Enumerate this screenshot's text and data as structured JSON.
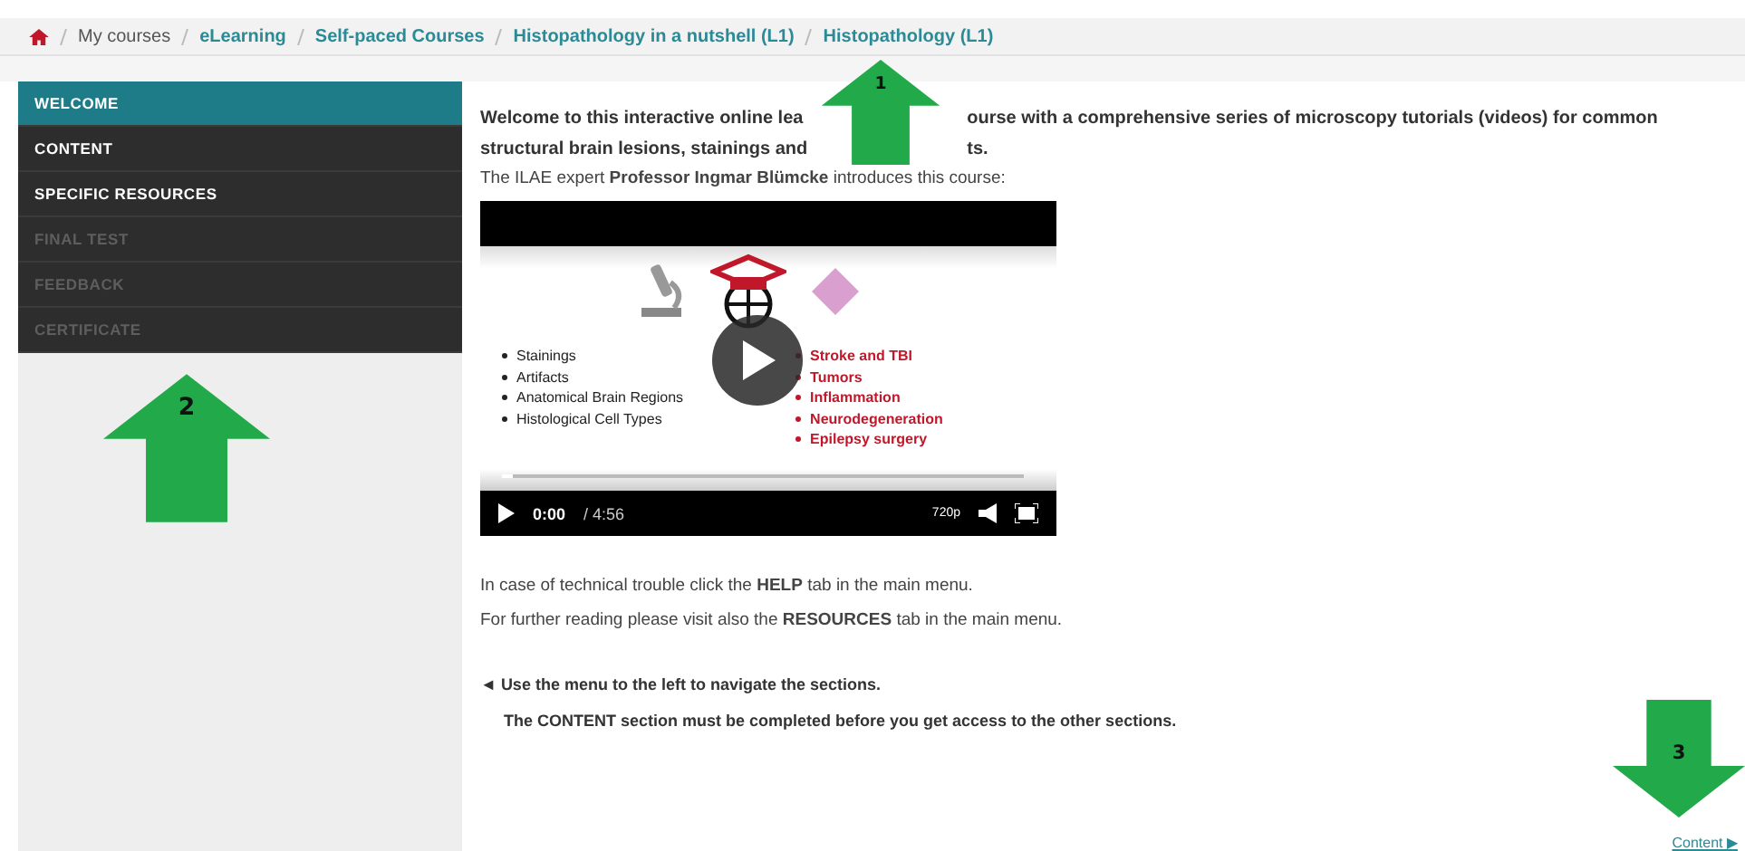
{
  "breadcrumb": [
    {
      "label": "My courses",
      "link": false
    },
    {
      "label": "eLearning",
      "link": true
    },
    {
      "label": "Self-paced Courses",
      "link": true
    },
    {
      "label": "Histopathology in a nutshell (L1)",
      "link": true
    },
    {
      "label": "Histopathology (L1)",
      "link": true
    }
  ],
  "sidebar": {
    "items": [
      {
        "label": "WELCOME",
        "selected": true,
        "disabled": false
      },
      {
        "label": "CONTENT",
        "selected": false,
        "disabled": false
      },
      {
        "label": "SPECIFIC RESOURCES",
        "selected": false,
        "disabled": false
      },
      {
        "label": "FINAL TEST",
        "selected": false,
        "disabled": true
      },
      {
        "label": "FEEDBACK",
        "selected": false,
        "disabled": true
      },
      {
        "label": "CERTIFICATE",
        "selected": false,
        "disabled": true
      }
    ]
  },
  "intro": {
    "line_1": [
      "Welcome to this interactive online lea",
      "ourse with a comprehensive series of microscopy tutorials (videos) for common"
    ],
    "line_2": [
      "structural brain lesions, stainings and",
      "ts."
    ],
    "expert": "The ILAE expert **Professor Ingmar Blümcke** introduces this course:"
  },
  "video": {
    "left_bullets": [
      "Stainings",
      "Artifacts",
      "Anatomical Brain Regions",
      "Histological Cell Types"
    ],
    "right_bullets": [
      "Stroke and TBI",
      "Tumors",
      "Inflammation",
      "Neurodegeneration",
      "Epilepsy surgery"
    ],
    "time": "0:00",
    "duration": "/ 4:56",
    "quality": "720p",
    "level": 0.02
  },
  "notes": [
    "In case of technical trouble click the **HELP** tab in the main menu.",
    "For further reading please visit also the **RESOURCES** tab in the main menu."
  ],
  "navigation": {
    "arrow": "◄",
    "hint": "Use the menu to the left to navigate the sections.",
    "requirement": "The CONTENT section must be completed before you get access to the other sections."
  },
  "next_link": "Content ▶",
  "markers": [
    {
      "label": "1",
      "kind": "up"
    },
    {
      "label": "2",
      "kind": "up"
    },
    {
      "label": "3",
      "kind": "down"
    }
  ]
}
